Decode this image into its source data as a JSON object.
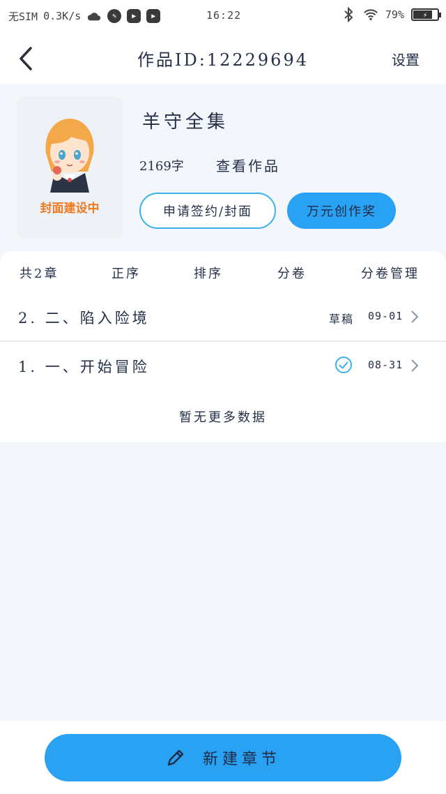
{
  "status_bar": {
    "carrier": "无SIM",
    "network_speed": "0.3K/s",
    "time": "16:22",
    "battery": "79%",
    "battery_level": 0.79
  },
  "nav": {
    "title": "作品ID:12229694",
    "settings": "设置"
  },
  "work": {
    "cover_label": "封面建设中",
    "title": "羊守全集",
    "word_count": "2169字",
    "view_link": "查看作品",
    "sign_button": "申请签约/封面",
    "award_button": "万元创作奖"
  },
  "toolbar": {
    "total": "共2章",
    "order": "正序",
    "sort": "排序",
    "volume": "分卷",
    "volume_manage": "分卷管理"
  },
  "chapters": [
    {
      "title": "2. 二、陷入险境",
      "status": "草稿",
      "date": "09-01"
    },
    {
      "title": "1. 一、开始冒险",
      "status": "",
      "date": "08-31"
    }
  ],
  "no_more": "暂无更多数据",
  "bottom": {
    "new_chapter": "新建章节"
  },
  "colors": {
    "accent": "#2aa2f3",
    "background": "#f3f6fa",
    "cover_label": "#f07a22"
  }
}
